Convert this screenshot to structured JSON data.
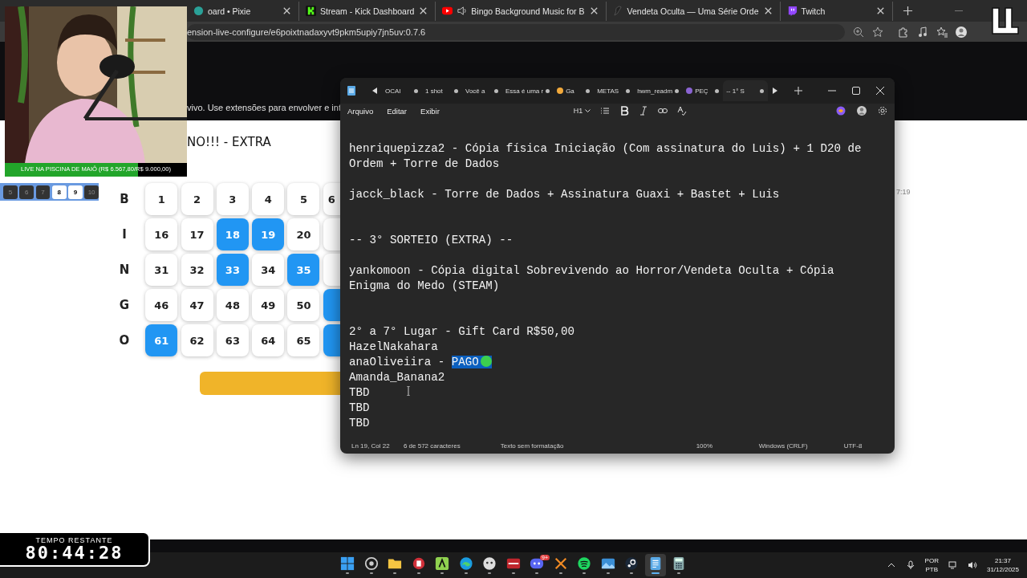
{
  "browser": {
    "tabs": [
      {
        "title": "oard • Pixie",
        "kind": "pixie"
      },
      {
        "title": "Stream - Kick Dashboard",
        "kind": "kick"
      },
      {
        "title": "Bingo Background Music for B",
        "kind": "youtube"
      },
      {
        "title": "Vendeta Oculta — Uma Série Orde",
        "kind": "vendeta"
      },
      {
        "title": "Twitch",
        "kind": "twitch"
      }
    ],
    "url": "ension-live-configure/e6poixtnadaxyvt9pkm5upiy7jn5uv:0.7.6"
  },
  "page": {
    "intro_text": "vivo. Use extensões para envolver e int",
    "title": "NO!!! - EXTRA",
    "timestamp": "7:19",
    "bingo": {
      "rows": [
        {
          "letter": "B",
          "cells": [
            {
              "number": "1",
              "called": false
            },
            {
              "number": "2",
              "called": false
            },
            {
              "number": "3",
              "called": false
            },
            {
              "number": "4",
              "called": false
            },
            {
              "number": "5",
              "called": false
            },
            {
              "number": "6",
              "called": false,
              "kind": "partial"
            }
          ]
        },
        {
          "letter": "I",
          "cells": [
            {
              "number": "16",
              "called": false
            },
            {
              "number": "17",
              "called": false
            },
            {
              "number": "18",
              "called": true
            },
            {
              "number": "19",
              "called": true
            },
            {
              "number": "20",
              "called": false
            },
            {
              "called": false,
              "kind": "partial"
            }
          ]
        },
        {
          "letter": "N",
          "cells": [
            {
              "number": "31",
              "called": false
            },
            {
              "number": "32",
              "called": false
            },
            {
              "number": "33",
              "called": true
            },
            {
              "number": "34",
              "called": false
            },
            {
              "number": "35",
              "called": true
            },
            {
              "called": false,
              "kind": "partial"
            }
          ]
        },
        {
          "letter": "G",
          "cells": [
            {
              "number": "46",
              "called": false
            },
            {
              "number": "47",
              "called": false
            },
            {
              "number": "48",
              "called": false
            },
            {
              "number": "49",
              "called": false
            },
            {
              "number": "50",
              "called": false
            },
            {
              "called": true,
              "kind": "partial"
            }
          ]
        },
        {
          "letter": "O",
          "cells": [
            {
              "number": "61",
              "called": true
            },
            {
              "number": "62",
              "called": false
            },
            {
              "number": "63",
              "called": false
            },
            {
              "number": "64",
              "called": false
            },
            {
              "number": "65",
              "called": false
            },
            {
              "called": true,
              "kind": "partial"
            }
          ]
        }
      ]
    }
  },
  "webcam": {
    "goal_text": "LIVE NA PISCINA DE MAIÔ (R$ 6.567,80/R$ 9.000,00)",
    "level": 0.73
  },
  "number_strip": [
    {
      "number": "5",
      "highlighted": false
    },
    {
      "number": "6",
      "highlighted": false
    },
    {
      "number": "7",
      "highlighted": false
    },
    {
      "number": "8",
      "highlighted": true
    },
    {
      "number": "9",
      "highlighted": true
    },
    {
      "number": "10",
      "highlighted": false
    }
  ],
  "timer": {
    "label": "TEMPO RESTANTE",
    "value": "80:44:28"
  },
  "notepad": {
    "tabs": [
      {
        "title": "OCAI",
        "selected": false
      },
      {
        "title": "1 shot",
        "selected": false
      },
      {
        "title": "Você a",
        "selected": false
      },
      {
        "title": "Essa é uma r",
        "selected": false
      },
      {
        "title": "Ga",
        "selected": false,
        "kind": "emoji"
      },
      {
        "title": "METAS",
        "selected": false
      },
      {
        "title": "hwm_readm",
        "selected": false
      },
      {
        "title": "PEÇ",
        "selected": false,
        "kind": "emoji"
      },
      {
        "title": "-- 1° S",
        "selected": true
      }
    ],
    "menu": [
      "Arquivo",
      "Editar",
      "Exibir"
    ],
    "heading": "H1",
    "lines": [
      {
        "kind": "text",
        "text": "henriquepizza2 - Cópia física Iniciação (Com assinatura do Luis) + 1 D20 de Ordem + Torre de Dados"
      },
      {
        "kind": "blank"
      },
      {
        "kind": "text",
        "text": "jacck_black - Torre de Dados + Assinatura Guaxi + Bastet + Luis"
      },
      {
        "kind": "blank"
      },
      {
        "kind": "blank"
      },
      {
        "kind": "text",
        "text": "-- 3° SORTEIO (EXTRA) --"
      },
      {
        "kind": "blank"
      },
      {
        "kind": "text",
        "text": "yankomoon - Cópia digital Sobrevivendo ao Horror/Vendeta Oculta + Cópia Enigma do Medo (STEAM)"
      },
      {
        "kind": "blank"
      },
      {
        "kind": "blank"
      },
      {
        "kind": "text",
        "text": "2° a 7° Lugar - Gift Card R$50,00"
      },
      {
        "kind": "text",
        "text": "HazelNakahara"
      },
      {
        "kind": "text",
        "text": "anaOliveiira - ",
        "selection": "PAGO"
      },
      {
        "kind": "text",
        "text": "Amanda_Banana2"
      },
      {
        "kind": "text",
        "text": "TBD"
      },
      {
        "kind": "text",
        "text": "TBD"
      },
      {
        "kind": "text",
        "text": "TBD"
      }
    ],
    "status": [
      "Ln 19, Col 22",
      "6 de 572 caracteres",
      "Texto sem formatação",
      "100%",
      "Windows (CRLF)",
      "UTF-8"
    ]
  },
  "taskbar": {
    "icons": [
      {
        "kind": "windows",
        "selected": false
      },
      {
        "kind": "circle",
        "selected": false
      },
      {
        "kind": "folder",
        "selected": false
      },
      {
        "kind": "red",
        "selected": false
      },
      {
        "kind": "green",
        "selected": false
      },
      {
        "kind": "edge",
        "selected": false
      },
      {
        "kind": "ball",
        "selected": false
      },
      {
        "kind": "mixer",
        "selected": false
      },
      {
        "kind": "discord",
        "selected": false,
        "badge": "9+"
      },
      {
        "kind": "cross",
        "selected": false
      },
      {
        "kind": "spotify",
        "selected": false
      },
      {
        "kind": "photos",
        "selected": false
      },
      {
        "kind": "steam",
        "selected": false
      },
      {
        "kind": "notepad",
        "selected": true
      },
      {
        "kind": "calculator",
        "selected": false
      }
    ],
    "language": "POR",
    "layout": "PTB",
    "time": "21:37",
    "date": "31/12/2025"
  }
}
